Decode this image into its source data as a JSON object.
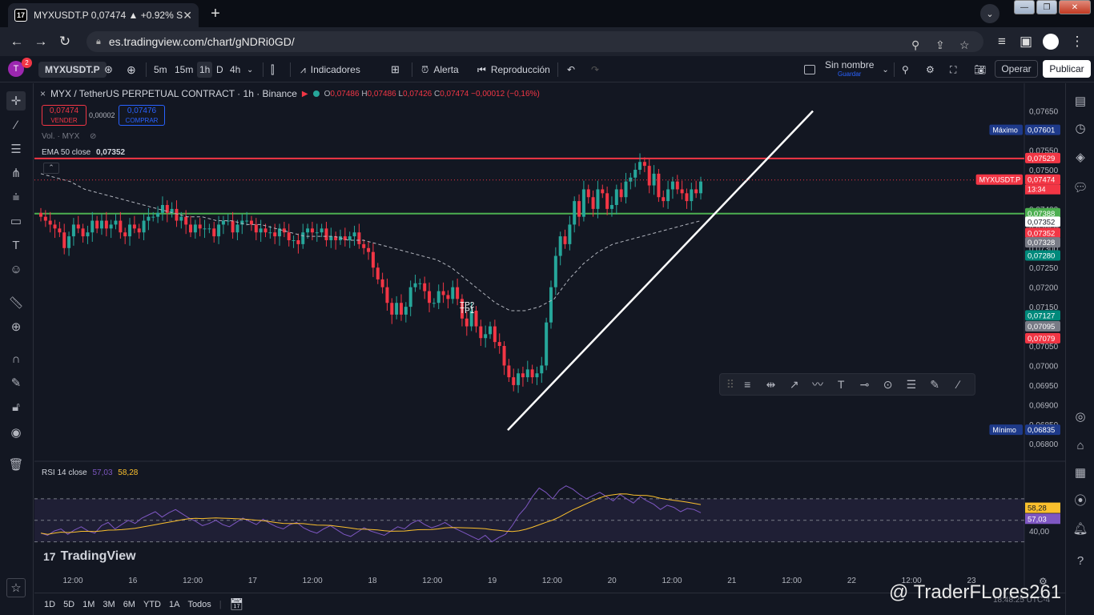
{
  "browser": {
    "tab_title": "MYXUSDT.P 0,07474 ▲ +0.92% S",
    "url": "es.tradingview.com/chart/gNDRi0GD/"
  },
  "toolbar": {
    "avatar_letter": "T",
    "notification_count": "2",
    "symbol": "MYXUSDT.P",
    "timeframes": [
      "5m",
      "15m",
      "1h",
      "D",
      "4h"
    ],
    "active_timeframe": "1h",
    "indicators": "Indicadores",
    "alert": "Alerta",
    "replay": "Reproducción",
    "layout_name": "Sin nombre",
    "save_label": "Guardar",
    "trade": "Operar",
    "publish": "Publicar"
  },
  "legend": {
    "title": "MYX / TetherUS PERPETUAL CONTRACT · 1h · Binance",
    "o_label": "O",
    "o": "0,07486",
    "h_label": "H",
    "h": "0,07486",
    "l_label": "L",
    "l": "0,07426",
    "c_label": "C",
    "c": "0,07474",
    "change": "−0,00012 (−0,16%)",
    "sell_price": "0,07474",
    "sell_label": "VENDER",
    "spread": "0,00002",
    "buy_price": "0,07476",
    "buy_label": "COMPRAR",
    "volume": "Vol. · MYX",
    "ema_label": "EMA 50 close",
    "ema_value": "0,07352"
  },
  "chart_data": {
    "type": "candlestick",
    "price_axis": [
      "0,07650",
      "0,07600",
      "0,07550",
      "0,07500",
      "0,07450",
      "0,07400",
      "0,07350",
      "0,07300",
      "0,07250",
      "0,07200",
      "0,07150",
      "0,07100",
      "0,07050",
      "0,07000",
      "0,06950",
      "0,06900",
      "0,06850",
      "0,06800"
    ],
    "ylim": [
      0.0678,
      0.0768
    ],
    "time_axis": [
      "12:00",
      "16",
      "12:00",
      "17",
      "12:00",
      "18",
      "12:00",
      "19",
      "12:00",
      "20",
      "12:00",
      "21",
      "12:00",
      "22",
      "12:00",
      "23"
    ],
    "horizontal_lines": [
      {
        "value": 0.07529,
        "color": "#f23645"
      },
      {
        "value": 0.07388,
        "color": "#4caf50"
      }
    ],
    "price_tags": [
      {
        "label": "Máximo",
        "value": "0,07601"
      },
      {
        "label": "",
        "value": "0,07529"
      },
      {
        "label": "MYXUSDT.P",
        "value": "0,07474",
        "sub": "13:34"
      },
      {
        "label": "",
        "value": "0,07388"
      },
      {
        "label": "",
        "value": "0,07352"
      },
      {
        "label": "",
        "value": "0,07352"
      },
      {
        "label": "",
        "value": "0,07328"
      },
      {
        "label": "",
        "value": "0,07280"
      },
      {
        "label": "",
        "value": "0,07127"
      },
      {
        "label": "",
        "value": "0,07095"
      },
      {
        "label": "",
        "value": "0,07079"
      },
      {
        "label": "Mínimo",
        "value": "0,06835"
      }
    ],
    "annotations": [
      "TP2",
      "TP1"
    ],
    "trendline": {
      "from": 0.06835,
      "to": 0.0765
    },
    "close_path": [
      0.0738,
      0.0737,
      0.0736,
      0.0735,
      0.0734,
      0.073,
      0.0733,
      0.0736,
      0.0735,
      0.0733,
      0.0734,
      0.0737,
      0.0735,
      0.0737,
      0.0735,
      0.0736,
      0.0737,
      0.0734,
      0.0733,
      0.0736,
      0.0735,
      0.0734,
      0.0737,
      0.0738,
      0.0738,
      0.0739,
      0.0741,
      0.0739,
      0.074,
      0.0737,
      0.0738,
      0.0736,
      0.0734,
      0.0736,
      0.0735,
      0.0735,
      0.0735,
      0.0733,
      0.0736,
      0.0737,
      0.0737,
      0.0734,
      0.0736,
      0.0737,
      0.0737,
      0.0736,
      0.0734,
      0.0735,
      0.0734,
      0.0734,
      0.0733,
      0.0735,
      0.0734,
      0.0732,
      0.0732,
      0.0731,
      0.0734,
      0.0735,
      0.0734,
      0.0734,
      0.0735,
      0.0732,
      0.0733,
      0.0732,
      0.0733,
      0.0732,
      0.0733,
      0.0734,
      0.0731,
      0.073,
      0.0729,
      0.0725,
      0.0722,
      0.072,
      0.0716,
      0.0713,
      0.0716,
      0.0713,
      0.0715,
      0.072,
      0.0721,
      0.0721,
      0.0719,
      0.0716,
      0.0716,
      0.0719,
      0.0718,
      0.0717,
      0.072,
      0.0717,
      0.0712,
      0.071,
      0.0714,
      0.071,
      0.0707,
      0.0708,
      0.071,
      0.0706,
      0.0705,
      0.07,
      0.0697,
      0.0695,
      0.0698,
      0.0697,
      0.0699,
      0.0697,
      0.0698,
      0.07,
      0.0711,
      0.072,
      0.0728,
      0.0733,
      0.0731,
      0.0736,
      0.0742,
      0.0738,
      0.0745,
      0.0743,
      0.074,
      0.0745,
      0.0744,
      0.074,
      0.0741,
      0.0745,
      0.0743,
      0.0747,
      0.0748,
      0.075,
      0.0752,
      0.0751,
      0.0746,
      0.0749,
      0.0743,
      0.0742,
      0.0745,
      0.0747,
      0.0745,
      0.0744,
      0.0742,
      0.0745,
      0.0744,
      0.0747
    ],
    "ema_path": [
      0.0749,
      0.0748,
      0.0747,
      0.0745,
      0.0744,
      0.0743,
      0.0742,
      0.0741,
      0.074,
      0.0739,
      0.0738,
      0.0738,
      0.0737,
      0.0737,
      0.0736,
      0.0736,
      0.0735,
      0.0734,
      0.0733,
      0.0733,
      0.0733,
      0.0732,
      0.0732,
      0.0731,
      0.073,
      0.0729,
      0.0728,
      0.0727,
      0.0725,
      0.0722,
      0.0719,
      0.0716,
      0.0714,
      0.0714,
      0.0715,
      0.0717,
      0.0722,
      0.0726,
      0.0729,
      0.0731,
      0.0732,
      0.0733,
      0.0734,
      0.0735,
      0.0736,
      0.0737
    ],
    "rsi": {
      "label": "RSI 14 close",
      "value": "57,03",
      "ma": "58,28",
      "level": "40,00",
      "series": [
        38,
        36,
        40,
        42,
        37,
        41,
        44,
        40,
        38,
        45,
        48,
        42,
        46,
        50,
        47,
        52,
        55,
        58,
        53,
        57,
        60,
        56,
        52,
        49,
        45,
        47,
        50,
        46,
        44,
        48,
        52,
        49,
        46,
        51,
        47,
        44,
        42,
        46,
        48,
        43,
        40,
        38,
        42,
        45,
        41,
        37,
        35,
        39,
        43,
        40,
        38,
        36,
        40,
        44,
        42,
        47,
        50,
        46,
        43,
        45,
        48,
        44,
        41,
        38,
        35,
        32,
        36,
        30,
        34,
        37,
        45,
        55,
        62,
        72,
        80,
        76,
        70,
        78,
        82,
        79,
        74,
        70,
        73,
        76,
        72,
        68,
        74,
        70,
        66,
        72,
        68,
        65,
        60,
        64,
        62,
        58,
        61,
        60,
        57
      ]
    }
  },
  "tool_palette": [
    "≡",
    "⇹",
    "↗",
    "〰",
    "T",
    "⊸",
    "⊙",
    "☰",
    "✎",
    "∕"
  ],
  "timeframe_bar": [
    "1D",
    "5D",
    "1M",
    "3M",
    "6M",
    "YTD",
    "1A",
    "Todos"
  ],
  "watermark": "TradingView",
  "credit": "@ TraderFLores261",
  "clock": "18:48:25 UTC-4"
}
